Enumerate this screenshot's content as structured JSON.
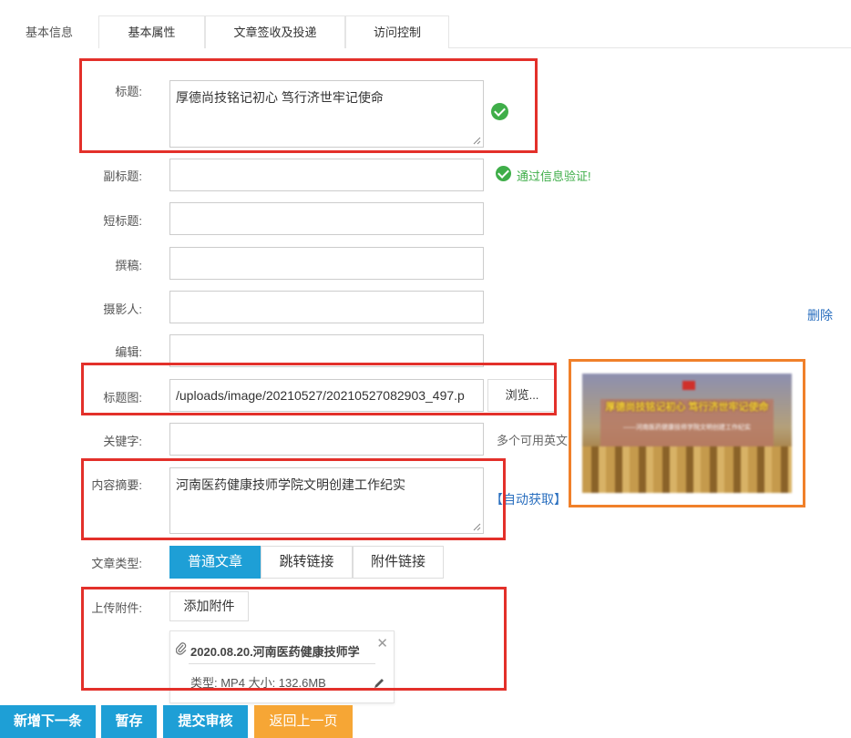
{
  "tabs": [
    "基本信息",
    "基本属性",
    "文章签收及投递",
    "访问控制"
  ],
  "toolbar": {
    "font_icon": "ℱ",
    "size_icon": "тT",
    "color_icon": "A"
  },
  "fields": {
    "title": {
      "label": "标题:",
      "value": "厚德尚技铭记初心 笃行济世牢记使命"
    },
    "subtitle": {
      "label": "副标题:",
      "value": ""
    },
    "short_title": {
      "label": "短标题:",
      "value": ""
    },
    "author": {
      "label": "撰稿:",
      "value": ""
    },
    "photographer": {
      "label": "摄影人:",
      "value": ""
    },
    "editor": {
      "label": "编辑:",
      "value": ""
    },
    "title_image": {
      "label": "标题图:",
      "value": "/uploads/image/20210527/20210527082903_497.p",
      "browse": "浏览..."
    },
    "keywords": {
      "label": "关键字:",
      "value": "",
      "hint": "多个可用英文"
    },
    "summary": {
      "label": "内容摘要:",
      "value": "河南医药健康技师学院文明创建工作纪实",
      "auto": "【自动获取】"
    },
    "article_type": {
      "label": "文章类型:",
      "options": [
        "普通文章",
        "跳转链接",
        "附件链接"
      ],
      "selected": "普通文章"
    },
    "upload": {
      "label": "上传附件:",
      "add": "添加附件"
    }
  },
  "validation": {
    "message": "通过信息验证!"
  },
  "delete_link": "删除",
  "thumbnail": {
    "title_text": "厚德尚技铭记初心 笃行济世牢记使命",
    "sub_text": "——河南医药健康技师学院文明创建工作纪实"
  },
  "attachment": {
    "name": "2020.08.20.河南医药健康技师学",
    "meta": "类型: MP4 大小: 132.6MB"
  },
  "actions": [
    "新增下一条",
    "暂存",
    "提交审核",
    "返回上一页"
  ],
  "colors": {
    "primary": "#1e9fd6",
    "warning": "#f6a635",
    "success": "#3fae49",
    "highlight_red": "#e3302a",
    "highlight_orange": "#f0802a"
  }
}
